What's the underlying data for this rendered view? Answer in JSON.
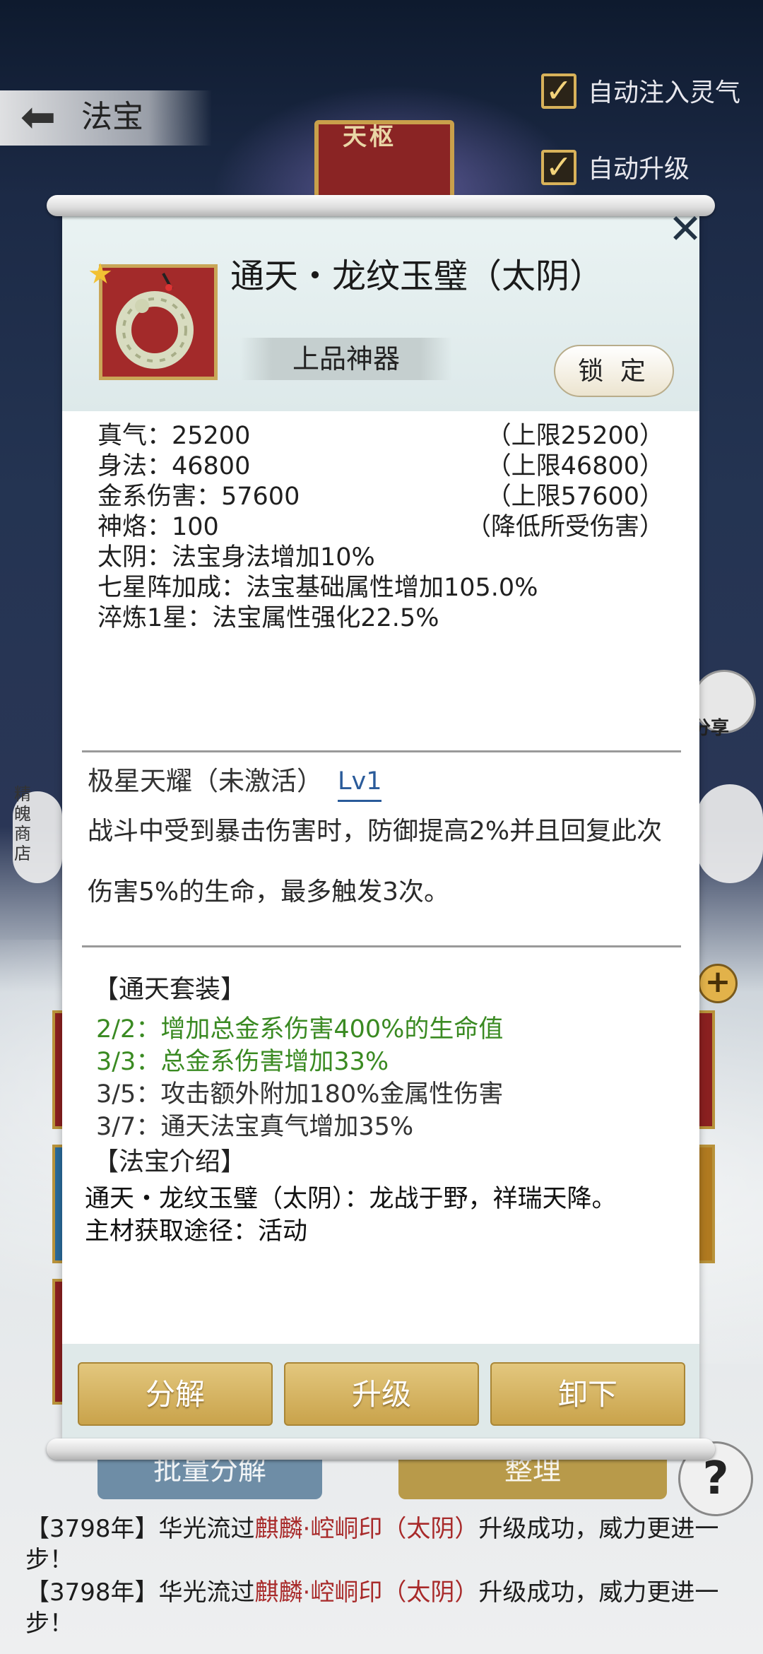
{
  "header": {
    "title": "法宝",
    "tianshu_label": "天枢"
  },
  "options": [
    {
      "label": "自动注入灵气",
      "checked": true
    },
    {
      "label": "自动升级",
      "checked": true
    }
  ],
  "background": {
    "share_label": "分享",
    "shop_label": "精魄商店",
    "batch_button": "批量分解",
    "sort_button": "整理",
    "help": "?",
    "log": [
      {
        "pre": "【3798年】华光流过",
        "item": "麒麟·崆峒印（太阴）",
        "post": "升级成功，威力更进一",
        "cont": "步！"
      },
      {
        "pre": "【3798年】华光流过",
        "item": "麒麟·崆峒印（太阴）",
        "post": "升级成功，威力更进一",
        "cont": "步！"
      }
    ]
  },
  "item": {
    "name": "通天・龙纹玉璧（太阴）",
    "grade": "上品神器",
    "lock_label": "锁 定",
    "attributes": [
      {
        "label": "真气：25200",
        "limit": "（上限25200）"
      },
      {
        "label": "身法：46800",
        "limit": "（上限46800）"
      },
      {
        "label": "金系伤害：57600",
        "limit": "（上限57600）"
      },
      {
        "label": "神烙：100",
        "limit": "（降低所受伤害）"
      }
    ],
    "bonus_taiyin": "太阴：法宝身法增加10%",
    "bonus_seven_star": "七星阵加成：法宝基础属性增加105.0%",
    "bonus_refine": "淬炼1星：法宝属性强化22.5%",
    "skill": {
      "name": "极星天耀（未激活）",
      "level": "Lv1",
      "desc": "战斗中受到暴击伤害时，防御提高2%并且回复此次伤害5%的生命，最多触发3次。"
    },
    "set": {
      "title": "【通天套装】",
      "effects": [
        {
          "text": "2/2：增加总金系伤害400%的生命值",
          "active": true
        },
        {
          "text": "3/3：总金系伤害增加33%",
          "active": true
        },
        {
          "text": "3/5：攻击额外附加180%金属性伤害",
          "active": false
        },
        {
          "text": "3/7：通天法宝真气增加35%",
          "active": false
        }
      ]
    },
    "intro": {
      "title": "【法宝介绍】",
      "lines": [
        "通天・龙纹玉璧（太阴）：龙战于野，祥瑞天降。",
        "主材获取途径：活动"
      ]
    }
  },
  "actions": {
    "decompose": "分解",
    "upgrade": "升级",
    "unequip": "卸下"
  },
  "colors": {
    "gold_button": "#c9a34b",
    "active_set": "#3a8a22",
    "highlight_red": "#a82a2a",
    "level_blue": "#2a5b9a"
  }
}
